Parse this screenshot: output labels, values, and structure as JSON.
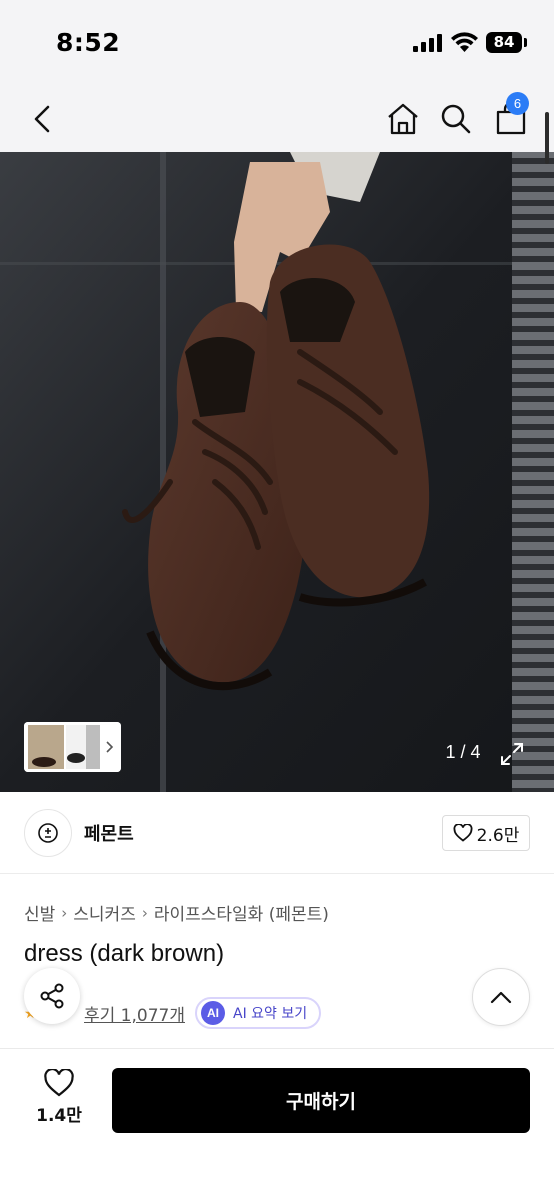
{
  "status_bar": {
    "time": "8:52",
    "battery": "84"
  },
  "nav": {
    "cart_count": "6"
  },
  "gallery": {
    "counter": "1 / 4"
  },
  "brand": {
    "name": "페몬트",
    "likes": "2.6만"
  },
  "breadcrumb": [
    "신발",
    "스니커즈",
    "라이프스타일화 (페몬트)"
  ],
  "product": {
    "title": "dress (dark brown)",
    "reviews": "후기 1,077개",
    "ai_badge": "AI",
    "ai_summary": "AI 요약 보기"
  },
  "bottom": {
    "wish_count": "1.4만",
    "buy_label": "구매하기"
  },
  "colors": {
    "accent": "#2b7cf6",
    "ai": "#5b5ce6",
    "buy_bg": "#000000",
    "shoe": "#4a2c22"
  },
  "icons": [
    "back-icon",
    "home-icon",
    "search-icon",
    "cart-icon",
    "expand-icon",
    "brand-logo-icon",
    "heart-icon",
    "share-icon",
    "chevron-up-icon"
  ]
}
